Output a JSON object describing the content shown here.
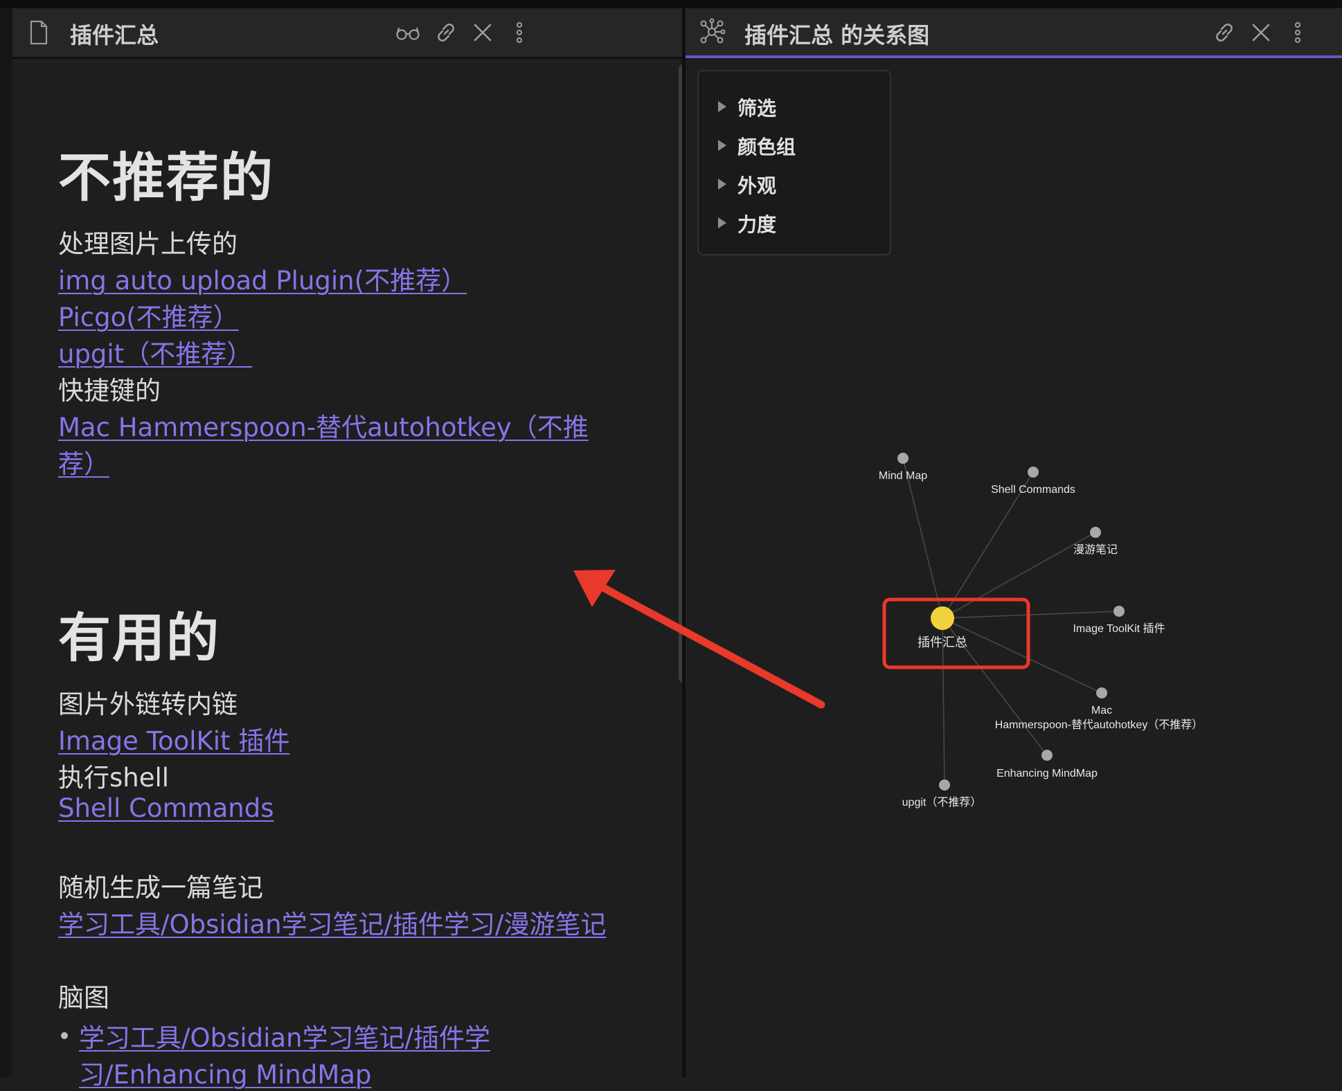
{
  "left_pane": {
    "title": "插件汇总",
    "icons": [
      "document-icon",
      "reading-glasses-icon",
      "link-icon",
      "close-icon",
      "more-vertical-icon"
    ],
    "sections": [
      {
        "heading": "不推荐的",
        "items": [
          {
            "text": "处理图片上传的",
            "link": false
          },
          {
            "text": "img auto upload Plugin(不推荐）",
            "link": true
          },
          {
            "text": "Picgo(不推荐）",
            "link": true
          },
          {
            "text": "upgit（不推荐）",
            "link": true
          },
          {
            "text": "快捷键的",
            "link": false
          },
          {
            "text": "Mac Hammerspoon-替代autohotkey（不推",
            "link": true
          },
          {
            "text": "荐）",
            "link": true
          }
        ]
      },
      {
        "heading": "有用的",
        "items": [
          {
            "text": "图片外链转内链",
            "link": false
          },
          {
            "text": "Image ToolKit 插件",
            "link": true
          },
          {
            "text": "执行shell",
            "link": false
          },
          {
            "text": "Shell Commands",
            "link": true
          },
          {
            "text": "随机生成一篇笔记",
            "link": false
          },
          {
            "text": "学习工具/Obsidian学习笔记/插件学习/漫游笔记",
            "link": true
          },
          {
            "text": "脑图",
            "link": false
          },
          {
            "text": "学习工具/Obsidian学习笔记/插件学",
            "link": true,
            "bullet": true
          },
          {
            "text": "习/Enhancing MindMap",
            "link": true
          }
        ]
      }
    ]
  },
  "right_pane": {
    "title": "插件汇总 的关系图",
    "icons": [
      "graph-icon",
      "link-icon",
      "close-icon",
      "more-vertical-icon"
    ],
    "settings": [
      "筛选",
      "颜色组",
      "外观",
      "力度"
    ]
  },
  "graph": {
    "center_node": "插件汇总",
    "nodes": [
      {
        "label": "Mind Map"
      },
      {
        "label": "Shell Commands"
      },
      {
        "label": "漫游笔记"
      },
      {
        "label": "Image ToolKit 插件"
      },
      {
        "label_lines": [
          "Mac",
          "Hammerspoon-替代autohotkey（不推荐）"
        ]
      },
      {
        "label": "Enhancing MindMap"
      },
      {
        "label": "upgit（不推荐）"
      }
    ],
    "colors": {
      "center": "#f0d23c",
      "node": "#a8a8a8",
      "edge": "#4a4a4a",
      "highlight": "#e8392b",
      "arrow": "#e8392b"
    }
  }
}
